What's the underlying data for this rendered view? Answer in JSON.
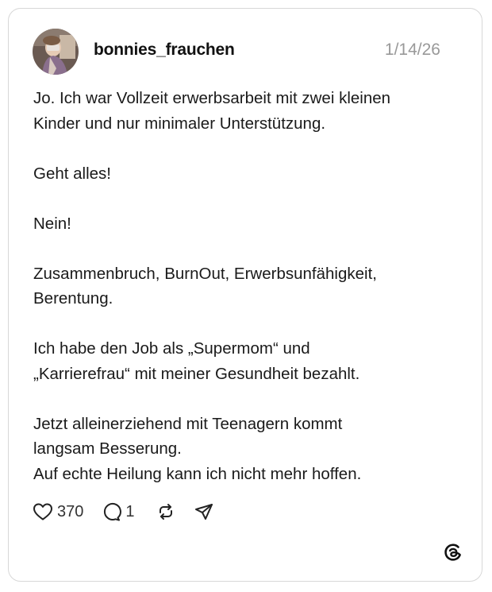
{
  "post": {
    "username": "bonnies_frauchen",
    "date": "1/14/26",
    "paragraphs": [
      [
        "Jo. Ich war Vollzeit erwerbsarbeit mit zwei kleinen",
        "Kinder und nur minimaler Unterstützung."
      ],
      [
        "Geht alles!"
      ],
      [
        "Nein!"
      ],
      [
        "Zusammenbruch, BurnOut, Erwerbsunfähigkeit,",
        "Berentung."
      ],
      [
        "Ich habe den Job als „Supermom“ und",
        "„Karrierefrau“ mit meiner Gesundheit bezahlt."
      ],
      [
        "Jetzt alleinerziehend mit Teenagern kommt",
        "langsam Besserung.",
        "Auf echte Heilung kann ich nicht mehr hoffen."
      ]
    ],
    "likes": "370",
    "replies": "1"
  },
  "icons": {
    "like": "heart-icon",
    "reply": "comment-bubble-icon",
    "repost": "repost-icon",
    "share": "send-icon",
    "brand": "threads-logo-icon"
  }
}
